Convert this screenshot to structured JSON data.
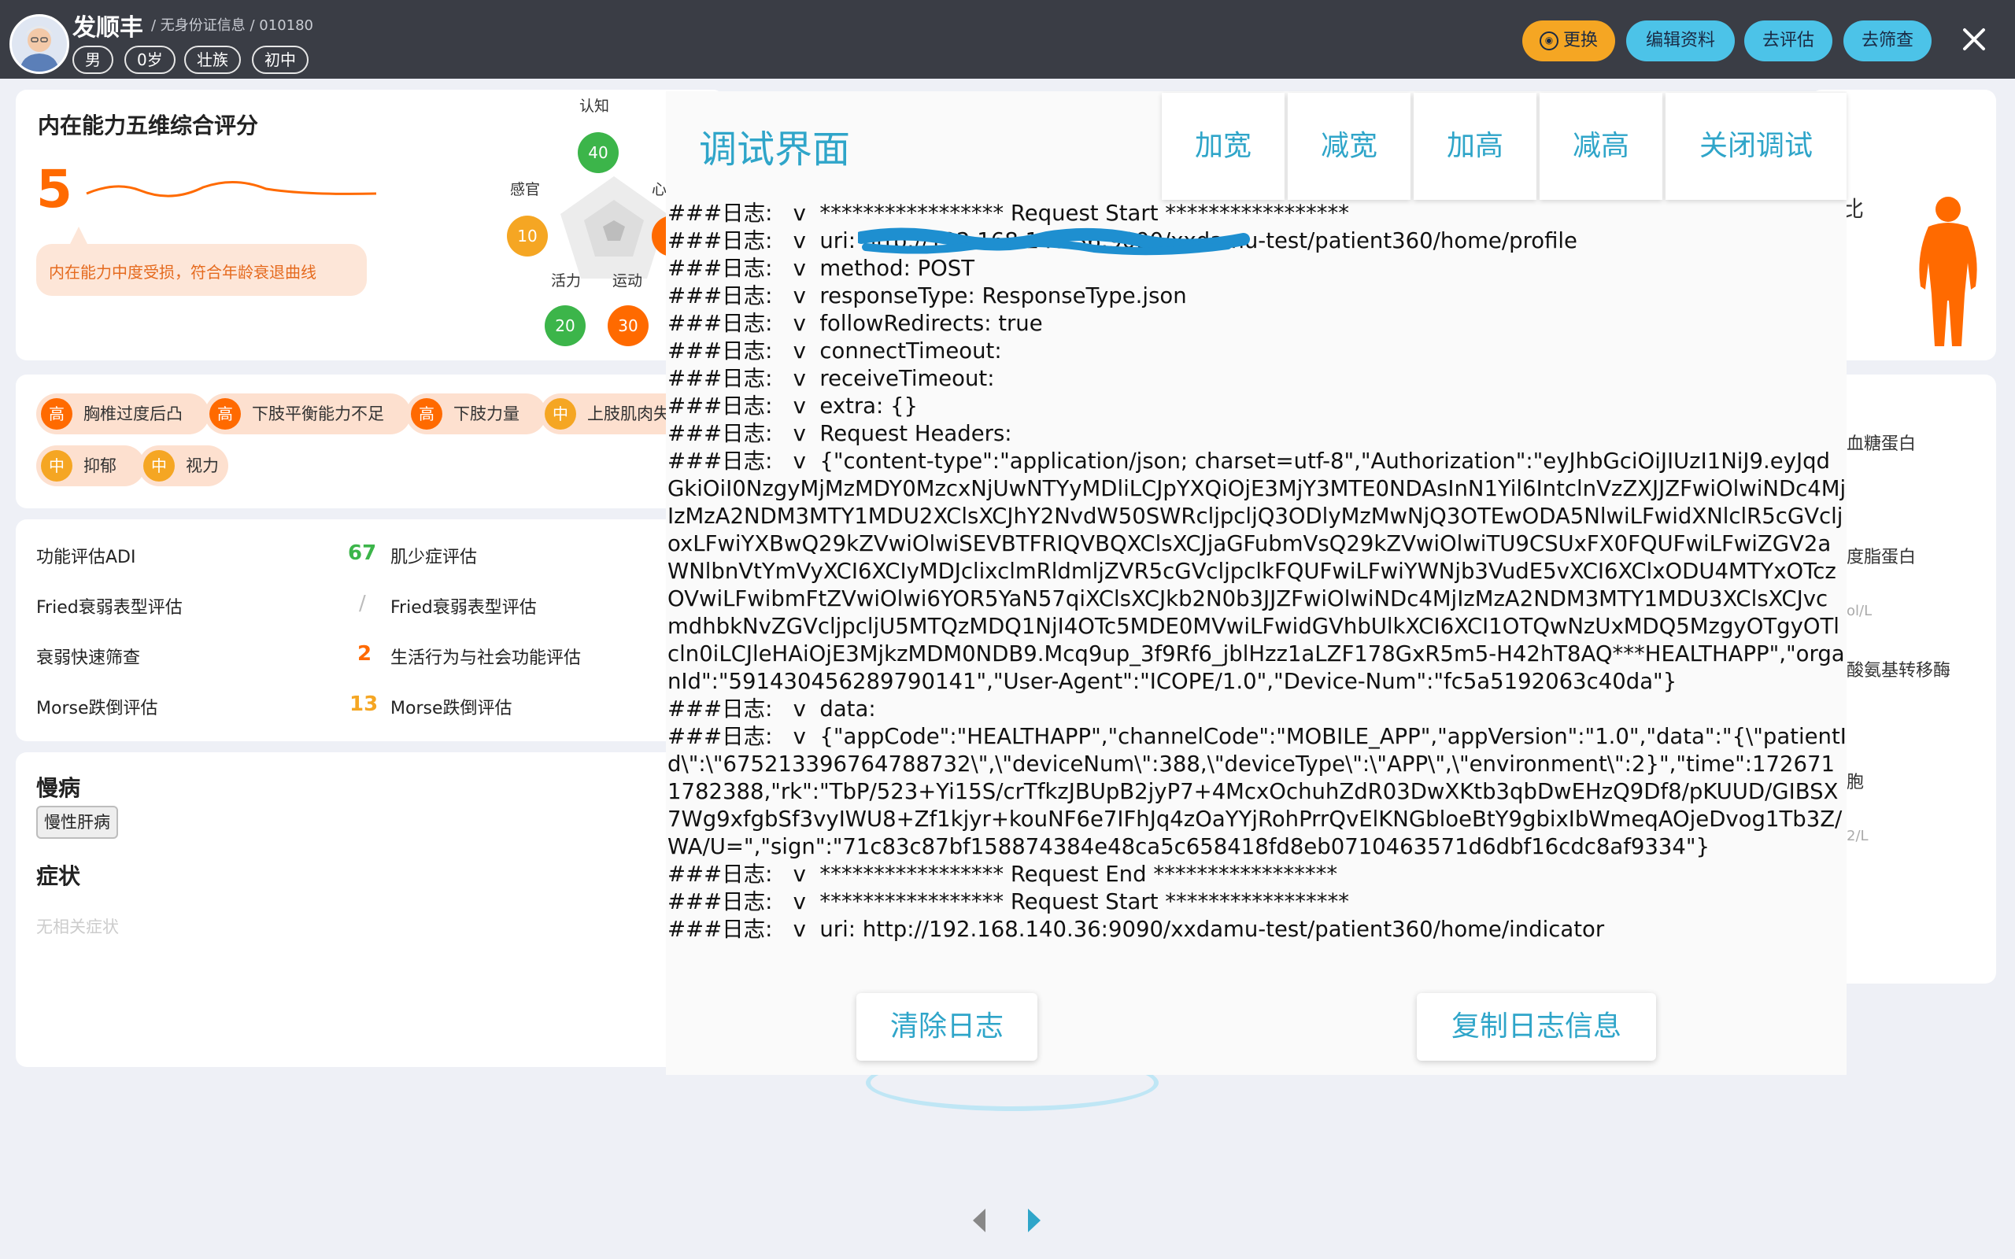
{
  "header": {
    "patient_name": "发顺丰",
    "patient_sub": "/ 无身份证信息 / 010180",
    "tags": [
      "男",
      "0岁",
      "壮族",
      "初中"
    ],
    "buttons": {
      "change": "更换",
      "edit": "编辑资料",
      "evaluate": "去评估",
      "screen": "去筛查"
    }
  },
  "ability": {
    "title": "内在能力五维综合评分",
    "score": "5",
    "note": "内在能力中度受损，符合年龄衰退曲线",
    "radar": {
      "cognition": {
        "label": "认知",
        "value": "40"
      },
      "sensory": {
        "label": "感官",
        "value": "10"
      },
      "psych": {
        "label": "心"
      },
      "vitality": {
        "label": "活力",
        "value": "20"
      },
      "motion": {
        "label": "运动",
        "value": "30"
      }
    }
  },
  "risks": [
    {
      "level": "高",
      "label": "胸椎过度后凸"
    },
    {
      "level": "高",
      "label": "下肢平衡能力不足"
    },
    {
      "level": "高",
      "label": "下肢力量"
    },
    {
      "level": "中",
      "label": "上肢肌肉失"
    },
    {
      "level": "中",
      "label": "抑郁"
    },
    {
      "level": "中",
      "label": "视力"
    }
  ],
  "assessments": [
    {
      "name": "功能评估ADI",
      "score": "67",
      "right": "肌少症评估"
    },
    {
      "name": "Fried衰弱表型评估",
      "score": "/",
      "right": "Fried衰弱表型评估"
    },
    {
      "name": "衰弱快速筛查",
      "score": "2",
      "right": "生活行为与社会功能评估"
    },
    {
      "name": "Morse跌倒评估",
      "score": "13",
      "right": "Morse跌倒评估"
    }
  ],
  "chronic": {
    "title": "慢病",
    "tag": "慢性肝病",
    "symptom_title": "症状",
    "symptom_empty": "无相关症状"
  },
  "side": {
    "ratio_label": "比",
    "items": [
      "血糖蛋白",
      "度脂蛋白",
      "ol/L",
      "酸氨基转移酶",
      "胞",
      "2/L"
    ]
  },
  "debug": {
    "title": "调试界面",
    "buttons": [
      "加宽",
      "减宽",
      "加高",
      "减高",
      "关闭调试"
    ],
    "log": "###日志:   v  ***************** Request Start *****************\n###日志:   v  uri: http://192.168.140.36:9090/xxdamu-test/patient360/home/profile\n###日志:   v  method: POST\n###日志:   v  responseType: ResponseType.json\n###日志:   v  followRedirects: true\n###日志:   v  connectTimeout:\n###日志:   v  receiveTimeout:\n###日志:   v  extra: {}\n###日志:   v  Request Headers:\n###日志:   v  {\"content-type\":\"application/json; charset=utf-8\",\"Authorization\":\"eyJhbGciOiJIUzI1NiJ9.eyJqdGkiOiI0NzgyMjMzMDY0MzcxNjUwNTYyMDliLCJpYXQiOjE3MjY3MTE0NDAsInN1Yil6IntclnVzZXJJZFwiOlwiNDc4MjIzMzA2NDM3MTY1MDU2XClsXCJhY2NvdW50SWRcljpcljQ3ODlyMzMwNjQ3OTEwODA5NlwiLFwidXNlclR5cGVcljoxLFwiYXBwQ29kZVwiOlwiSEVBTFRIQVBQXClsXCJjaGFubmVsQ29kZVwiOlwiTU9CSUxFX0FQUFwiLFwiZGV2aWNlbnVtYmVyXCI6XCIyMDJclixclmRldmljZVR5cGVcljpclkFQUFwiLFwiYWNjb3VudE5vXCI6XClxODU4MTYxOTczOVwiLFwibmFtZVwiOlwi6YOR5YaN57qiXClsXCJkb2N0b3JJZFwiOlwiNDc4MjIzMzA2NDM3MTY1MDU3XClsXCJvcmdhbkNvZGVcljpcljU5MTQzMDQ1NjI4OTc5MDE0MVwiLFwidGVhbUlkXCI6XCI1OTQwNzUxMDQ5MzgyOTgyOTlcln0iLCJleHAiOjE3MjkzMDM0NDB9.Mcq9up_3f9Rf6_jblHzz1aLZF178GxR5m5-H42hT8AQ***HEALTHAPP\",\"organId\":\"591430456289790141\",\"User-Agent\":\"ICOPE/1.0\",\"Device-Num\":\"fc5a5192063c40da\"}\n###日志:   v  data:\n###日志:   v  {\"appCode\":\"HEALTHAPP\",\"channelCode\":\"MOBILE_APP\",\"appVersion\":\"1.0\",\"data\":\"{\\\"patientId\\\":\\\"675213396764788732\\\",\\\"deviceNum\\\":388,\\\"deviceType\\\":\\\"APP\\\",\\\"environment\\\":2}\",\"time\":1726711782388,\"rk\":\"TbP/523+Yi15S/crTfkzJBUpB2jyP7+4McxOchuhZdR03DwXKtb3qbDwEHzQ9Df8/pKUUD/GIBSX7Wg9xfgbSf3vyIWU8+Zf1kjyr+kouNF6e7IFhJq4zOaYYjRohPrrQvElKNGbloeBtY9gbixIbWmeqAOjeDvog1Tb3Z/WA/U=\",\"sign\":\"71c83c87bf158874384e48ca5c658418fd8eb0710463571d6dbf16cdc8af9334\"}\n###日志:   v  ***************** Request End *****************\n###日志:   v  ***************** Request Start *****************\n###日志:   v  uri: http://192.168.140.36:9090/xxdamu-test/patient360/home/indicator",
    "clear_button": "清除日志",
    "copy_button": "复制日志信息"
  },
  "colors": {
    "accent_orange": "#ff6a00",
    "high_risk": "#ff6a00",
    "mid_risk": "#f5a623",
    "green": "#3cb54a",
    "debug_blue": "#2fa5c9"
  }
}
